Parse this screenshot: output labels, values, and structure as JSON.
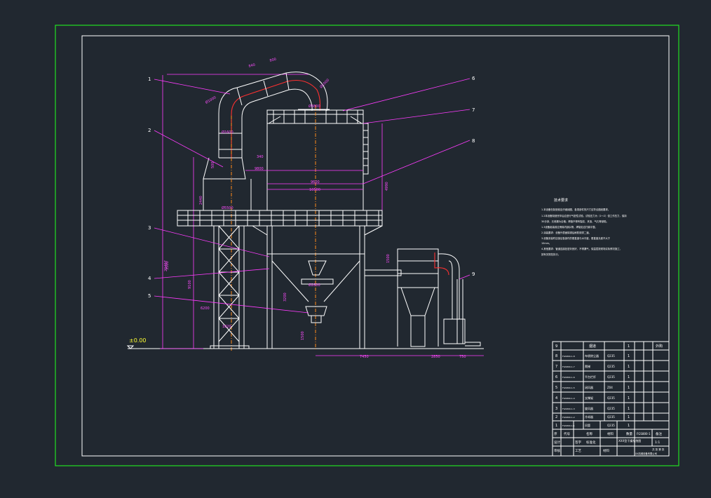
{
  "drawing": {
    "ground_level": "±0.00",
    "callouts": [
      "1",
      "2",
      "3",
      "4",
      "5",
      "6",
      "7",
      "8",
      "9"
    ],
    "dimensions": {
      "d_840": "840",
      "d_800": "800",
      "d_phi1000_a": "Ø1000",
      "d_phi1000_b": "Ø1000",
      "d_phi1600": "Ø1600",
      "d_phi3800": "Ø3800",
      "d_340": "340",
      "d_9800": "9800",
      "d_9600": "9600",
      "d_10500": "10500",
      "d_4990": "4990",
      "d_phi5500": "Ø5500",
      "d_2440": "2440",
      "d_500": "500",
      "d_phi2800": "Ø2800",
      "d_1500": "1500",
      "d_3500": "3500",
      "d_3200": "3200",
      "d_9100": "9100",
      "d_20497": "20497",
      "d_1500b": "1500",
      "d_6200": "6200",
      "d_1820": "1820",
      "d_7450": "7450",
      "d_2850": "2850",
      "d_750": "750"
    },
    "notes": {
      "title": "技术要求",
      "lines": [
        "1.本设备在制造前应仔细阅图，各零部件的尺寸应符合图纸要求。",
        "1.2本设备制造完毕后应进行气密性试验，试验压力为（1～2）倍工作压力，保持",
        "30分钟，无泄漏为合格；焊缝不得有裂纹、夹渣、气孔等缺陷。",
        "1.3设备组装前应清除内部杂物，焊接处应打磨平整。",
        "2.涂装要求：设备外表面除锈后刷防锈漆二道。",
        "3.设备安装时应保证各部件的垂直度与水平度，垂直度允差不大于",
        "10mm。",
        "4.其他要求：管道连接处密封良好，不得漏气，保温层按现场实际情况施工，",
        "按有关规范执行。"
      ]
    },
    "bom": {
      "header": {
        "seq": "序",
        "code": "代号",
        "name": "名称",
        "qty": "数量",
        "material": "材料",
        "remark": "备注"
      },
      "rows": [
        {
          "seq": "9",
          "code": "",
          "name": "烟道",
          "material": "",
          "qty": "1",
          "note": "外购"
        },
        {
          "seq": "8",
          "code": "FGS800-1-8",
          "name": "布袋除尘器",
          "material": "Q235",
          "qty": "1",
          "note": ""
        },
        {
          "seq": "7",
          "code": "FGS800-1-7",
          "name": "爬梯",
          "material": "Q235",
          "qty": "1",
          "note": ""
        },
        {
          "seq": "6",
          "code": "FGS800-1-6",
          "name": "平台栏杆",
          "material": "Q235",
          "qty": "1",
          "note": ""
        },
        {
          "seq": "5",
          "code": "FGS800-1-5",
          "name": "闭风器",
          "material": "Z04",
          "qty": "1",
          "note": ""
        },
        {
          "seq": "4",
          "code": "FGS800-1-4",
          "name": "支撑架",
          "material": "Q235",
          "qty": "1",
          "note": ""
        },
        {
          "seq": "3",
          "code": "FGS800-1-3",
          "name": "旋风器",
          "material": "Q235",
          "qty": "1",
          "note": ""
        },
        {
          "seq": "2",
          "code": "FGS800-1-2",
          "name": "冷却器",
          "material": "Q235",
          "qty": "1",
          "note": ""
        },
        {
          "seq": "1",
          "code": "FGS800-1-1",
          "name": "风管",
          "material": "Q235",
          "qty": "1",
          "note": ""
        }
      ]
    },
    "title_block": {
      "r1": [
        "标记",
        "处数",
        "分区",
        "更改文件号",
        "签名",
        "年月日"
      ],
      "r2": [
        "设计",
        "标准化"
      ],
      "r3": [
        "审核",
        "工艺"
      ],
      "r4": [
        "校对",
        "批准"
      ],
      "designer_sig": "签字",
      "material_label": "材料",
      "drawing_title": "XXX型干燥系统图",
      "drawing_no": "FGS800-1",
      "stage_label": "阶段标记",
      "weight_label": "重量",
      "scale_label": "比例",
      "scale": "1:1",
      "sheet": "共 张 第 张",
      "company": "XX机械设备有限公司"
    }
  }
}
